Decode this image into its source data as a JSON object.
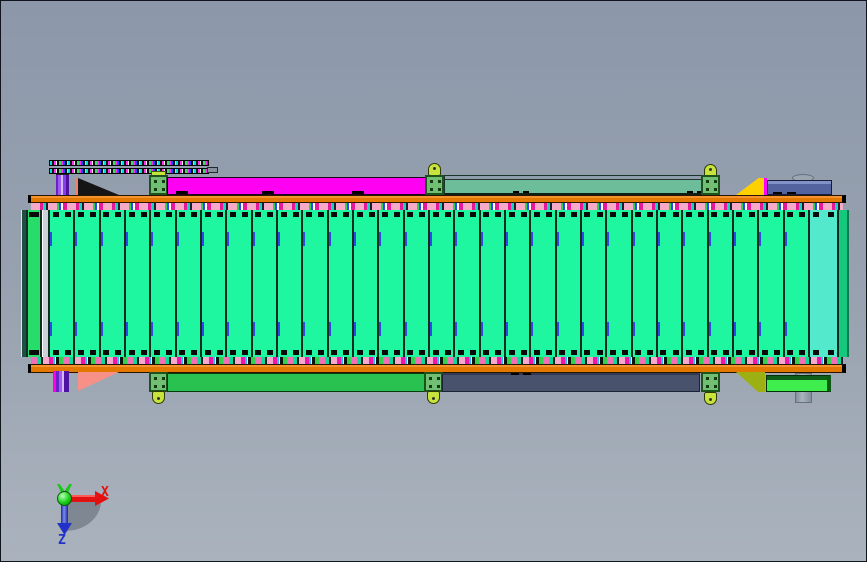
{
  "triad": {
    "x_label": "X",
    "z_label": "Z"
  },
  "conveyor": {
    "slat_count": 30
  },
  "colors": {
    "bg_top": "#8c98aa",
    "bg_mid": "#97a1af",
    "bg_bottom": "#aab3bd",
    "rail": "#e27800",
    "slat": "#1ef6a0",
    "sep": "#0e2c20",
    "bolt": "#0a0a0a",
    "tick": "#2d49e8",
    "first_slat": "#27dc68",
    "gray_slat": "#ccd1d8",
    "teal_slat": "#52e9cd",
    "right_edge": "#14c87e",
    "magenta_bar": "#ff00f2",
    "seafoam": "#6dbd9a",
    "slate_top": "#52639f",
    "slate_top_hi": "#8192c9",
    "slate_bottom": "#48526c",
    "green_bar": "#29c14f",
    "bright_green": "#3fee4e",
    "yellow_wedge": "#ffd000",
    "olive_wedge": "#9cb014",
    "bracket": "#71bf72",
    "bracket_edge": "#1c521c",
    "lug": "#c6e43c",
    "pink_wedge": "#f79187",
    "black_wedge": "#151515",
    "triad_red": "#e01212",
    "triad_blue": "#2232c8",
    "triad_green": "#1ac61a"
  }
}
